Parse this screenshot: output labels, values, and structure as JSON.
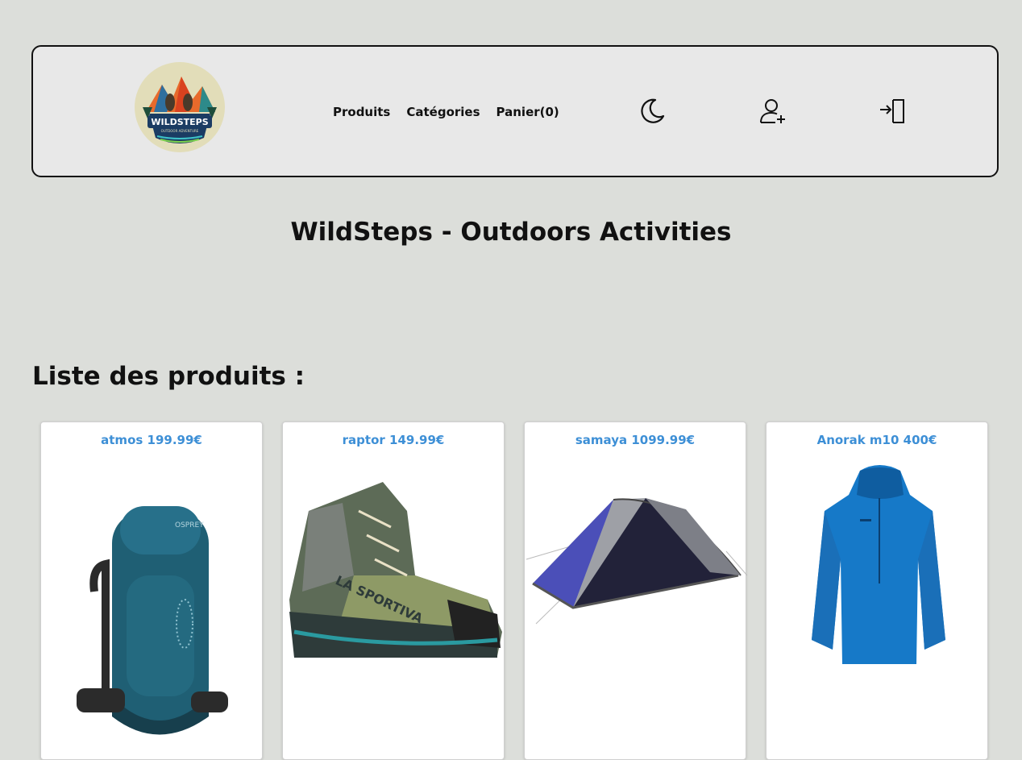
{
  "header": {
    "logo_text": "WILDSTEPS",
    "logo_subtext": "OUTDOOR ADVENTURE",
    "nav": [
      {
        "label": "Produits"
      },
      {
        "label": "Catégories"
      },
      {
        "label": "Panier(0)"
      }
    ],
    "icons": {
      "theme": "moon-icon",
      "register": "user-plus-icon",
      "login": "login-icon"
    }
  },
  "site_title": "WildSteps - Outdoors Activities",
  "list_title": "Liste des produits :",
  "products": [
    {
      "title": "atmos 199.99€",
      "image": "backpack"
    },
    {
      "title": "raptor 149.99€",
      "image": "hiking-boot"
    },
    {
      "title": "samaya 1099.99€",
      "image": "tent"
    },
    {
      "title": "Anorak m10 400€",
      "image": "jacket"
    }
  ],
  "colors": {
    "background": "#dcdeda",
    "header_bg": "#e8e8e8",
    "product_title": "#3d8fd6"
  }
}
